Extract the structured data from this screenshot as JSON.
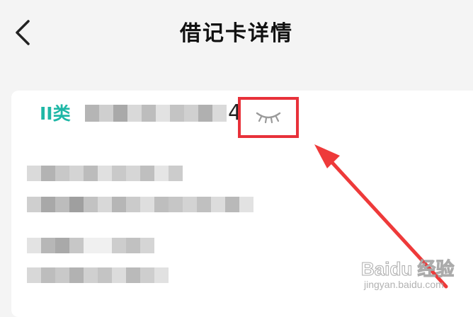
{
  "header": {
    "title": "借记卡详情",
    "back_icon": "chevron-left-icon"
  },
  "card": {
    "type_label": "II类",
    "number_visible_tail": "4",
    "eye_icon": "eye-closed-icon",
    "highlight_color": "#e8313a",
    "accent_color": "#1fb7a6"
  },
  "watermark": {
    "brand": "Baidu 经验",
    "url": "jingyan.baidu.com"
  }
}
